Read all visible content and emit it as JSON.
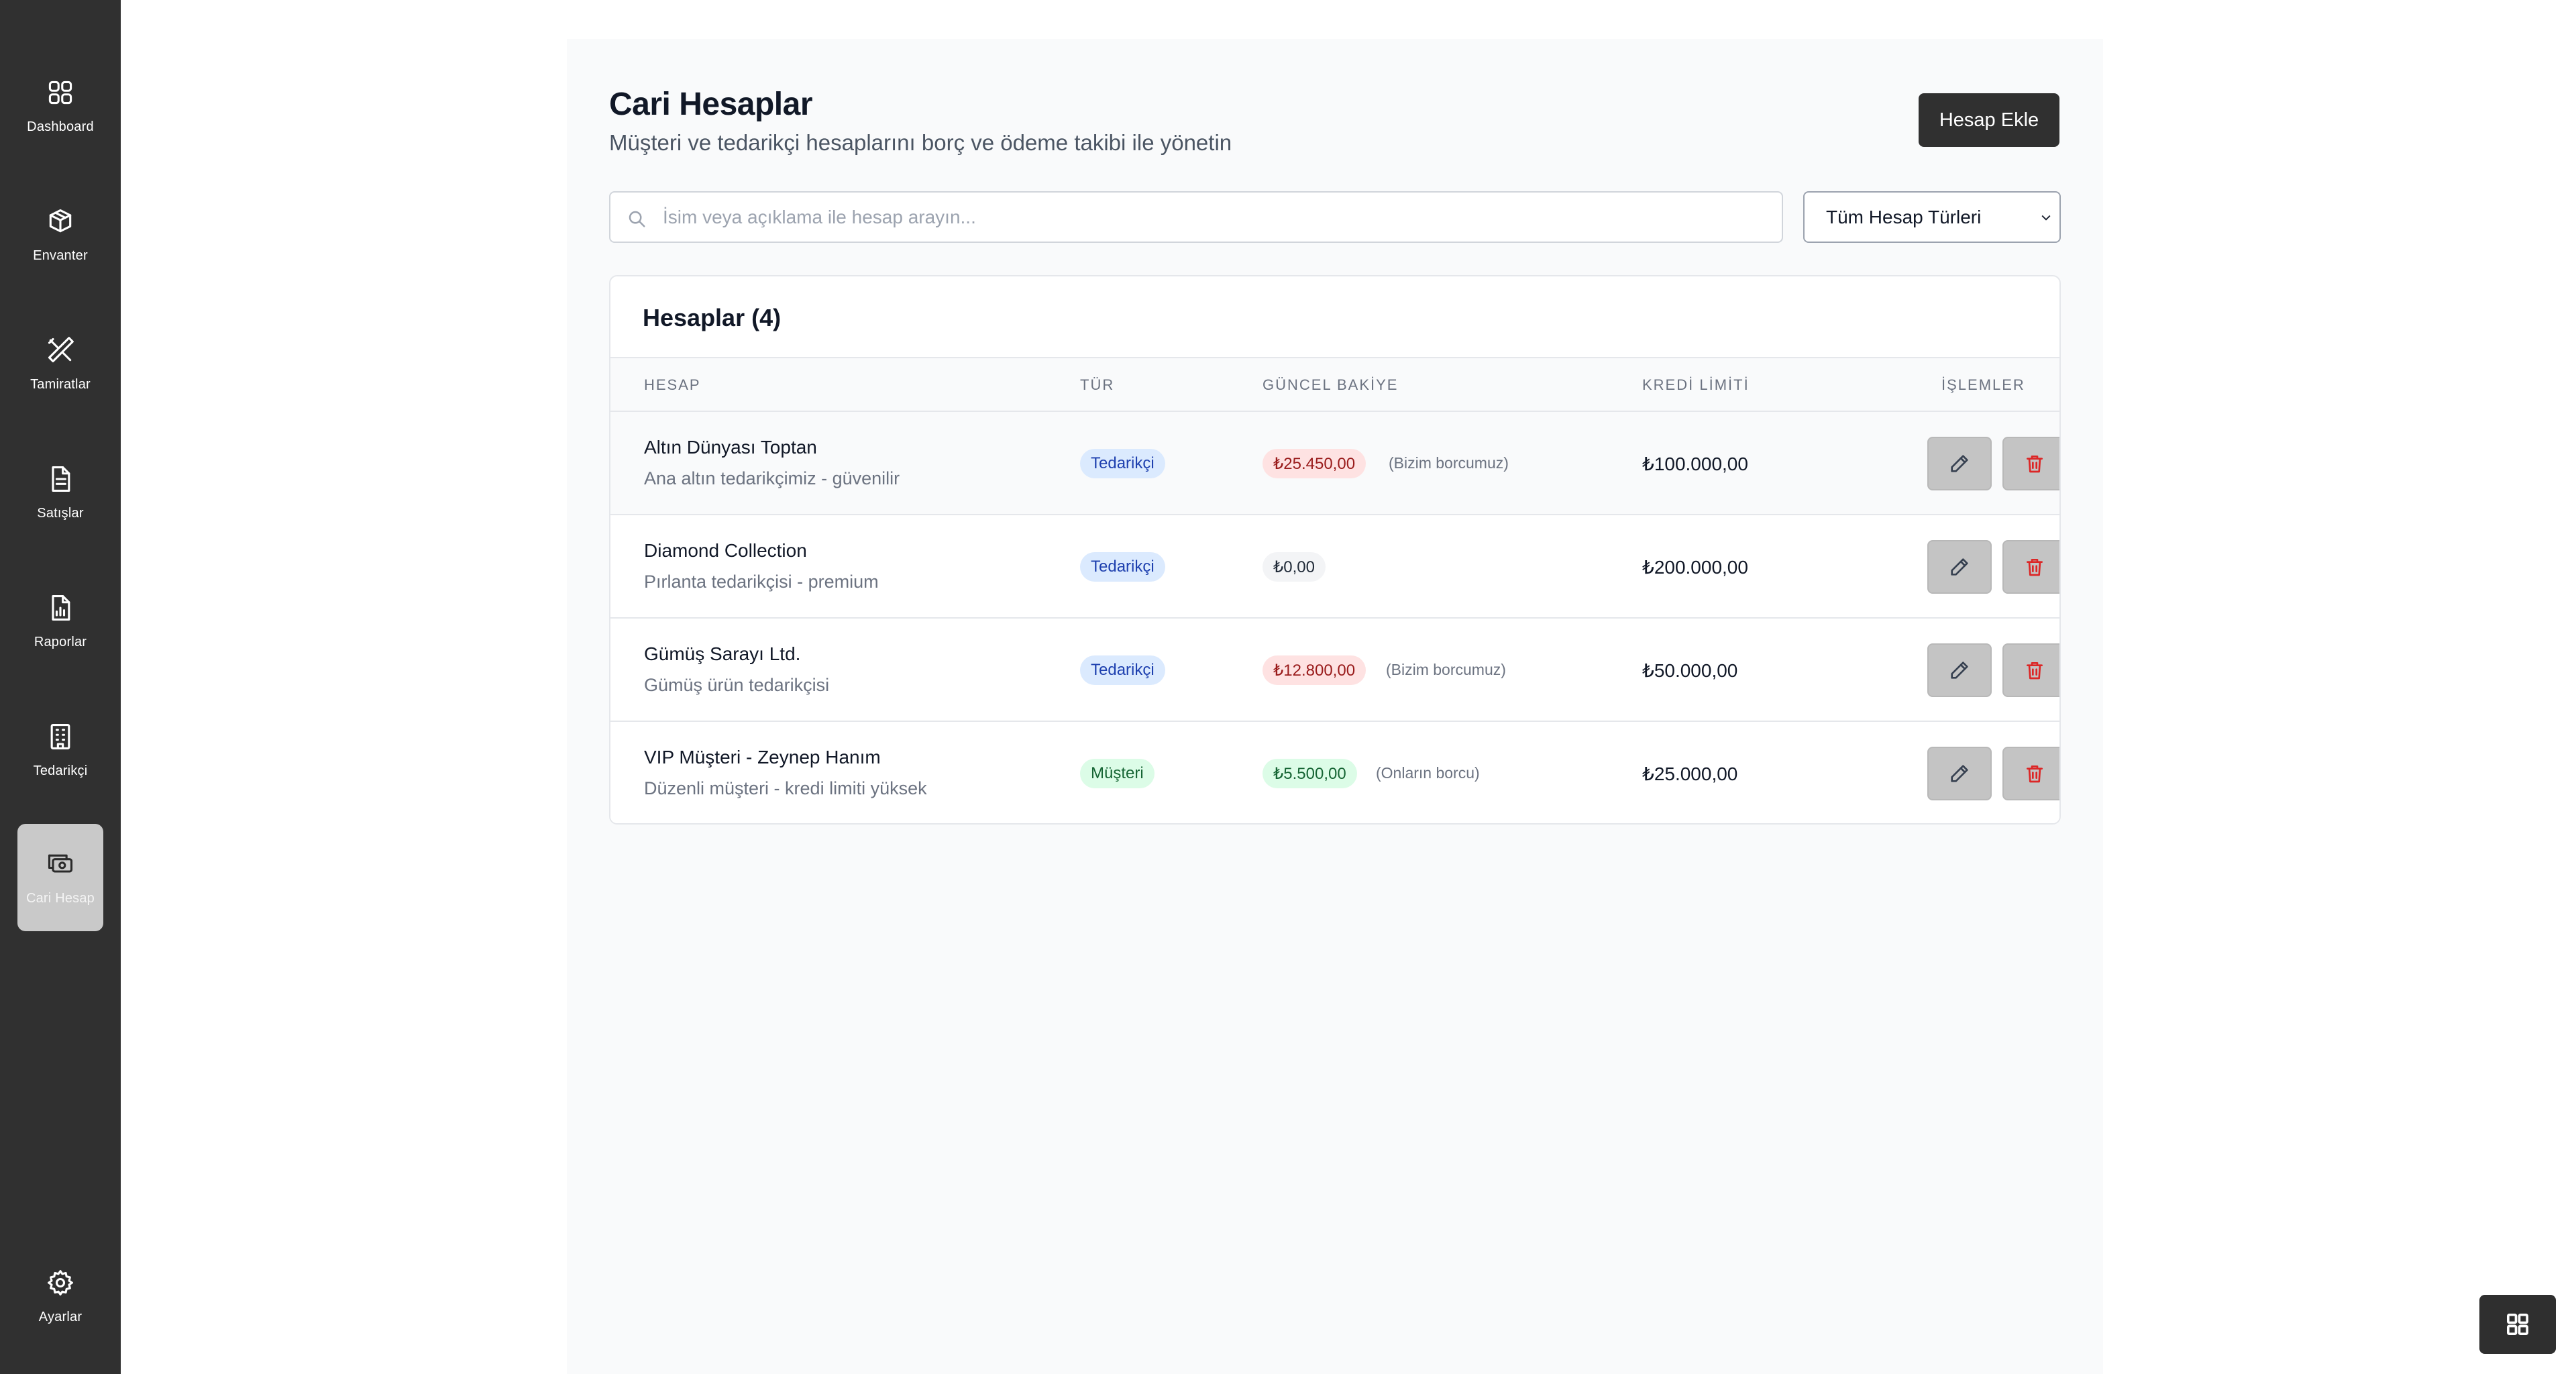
{
  "sidebar": {
    "items": [
      {
        "label": "Dashboard",
        "icon": "dashboard-grid-icon"
      },
      {
        "label": "Envanter",
        "icon": "box-icon"
      },
      {
        "label": "Tamiratlar",
        "icon": "tools-icon"
      },
      {
        "label": "Satışlar",
        "icon": "document-icon"
      },
      {
        "label": "Raporlar",
        "icon": "report-chart-icon"
      },
      {
        "label": "Tedarikçi",
        "icon": "building-icon"
      },
      {
        "label": "Cari Hesap",
        "icon": "money-icon",
        "active": true
      }
    ],
    "settings": {
      "label": "Ayarlar",
      "icon": "gear-icon"
    }
  },
  "header": {
    "title": "Cari Hesaplar",
    "subtitle": "Müşteri ve tedarikçi hesaplarını borç ve ödeme takibi ile yönetin",
    "add_button": "Hesap Ekle"
  },
  "filters": {
    "search_placeholder": "İsim veya açıklama ile hesap arayın...",
    "type_select": "Tüm Hesap Türleri"
  },
  "table": {
    "title": "Hesaplar (4)",
    "columns": [
      "HESAP",
      "TÜR",
      "GÜNCEL BAKİYE",
      "KREDİ LİMİTİ",
      "İŞLEMLER"
    ],
    "rows": [
      {
        "name": "Altın Dünyası Toptan",
        "description": "Ana altın tedarikçimiz - güvenilir",
        "type": "Tedarikçi",
        "balance": "₺25.450,00",
        "balance_note": "(Bizim borcumuz)",
        "balance_status": "debt",
        "credit_limit": "₺100.000,00"
      },
      {
        "name": "Diamond Collection",
        "description": "Pırlanta tedarikçisi - premium",
        "type": "Tedarikçi",
        "balance": "₺0,00",
        "balance_note": "",
        "balance_status": "zero",
        "credit_limit": "₺200.000,00"
      },
      {
        "name": "Gümüş Sarayı Ltd.",
        "description": "Gümüş ürün tedarikçisi",
        "type": "Tedarikçi",
        "balance": "₺12.800,00",
        "balance_note": "(Bizim borcumuz)",
        "balance_status": "debt",
        "credit_limit": "₺50.000,00"
      },
      {
        "name": "VIP Müşteri - Zeynep Hanım",
        "description": "Düzenli müşteri - kredi limiti yüksek",
        "type": "Müşteri",
        "balance": "₺5.500,00",
        "balance_note": "(Onların borcu)",
        "balance_status": "receivable",
        "credit_limit": "₺25.000,00"
      }
    ]
  },
  "colors": {
    "sidebar_bg": "#303030",
    "primary_button": "#303030",
    "supplier_badge": "#dbeafe",
    "customer_badge": "#dcfce7",
    "debt_badge": "#fee2e2",
    "delete_icon": "#dc2626"
  },
  "floating_widget": {
    "icon": "grid-icon"
  }
}
